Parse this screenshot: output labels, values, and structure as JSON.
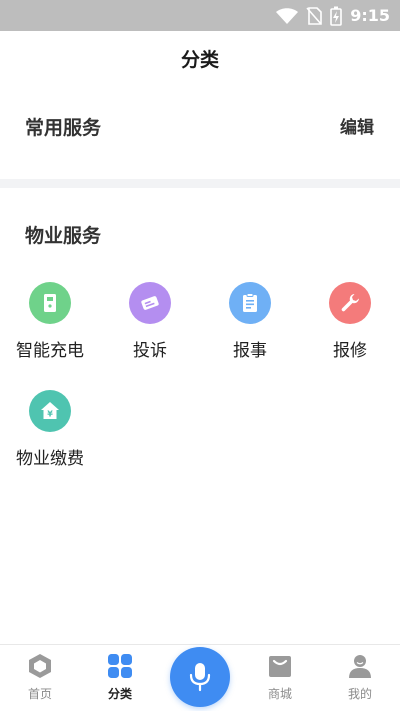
{
  "status_bar": {
    "time": "9:15"
  },
  "header": {
    "title": "分类"
  },
  "common_services": {
    "title": "常用服务",
    "edit_label": "编辑"
  },
  "property_services": {
    "title": "物业服务",
    "items": [
      {
        "label": "智能充电",
        "icon": "charging-pile-icon",
        "color": "#6fd28a"
      },
      {
        "label": "投诉",
        "icon": "complaint-ticket-icon",
        "color": "#b48ef0"
      },
      {
        "label": "报事",
        "icon": "clipboard-icon",
        "color": "#6fb0f5"
      },
      {
        "label": "报修",
        "icon": "wrench-icon",
        "color": "#f47b7b"
      },
      {
        "label": "物业缴费",
        "icon": "house-yen-icon",
        "color": "#4fc4b0"
      }
    ]
  },
  "tab_bar": {
    "items": [
      {
        "label": "首页",
        "icon": "home-hexagon-icon"
      },
      {
        "label": "分类",
        "icon": "category-grid-icon",
        "active": true
      },
      {
        "label": "商城",
        "icon": "shopping-bag-icon"
      },
      {
        "label": "我的",
        "icon": "user-icon"
      }
    ],
    "voice": {
      "icon": "microphone-icon"
    },
    "accent_color": "#3f8cf2",
    "inactive_color": "#8a8a8a"
  }
}
